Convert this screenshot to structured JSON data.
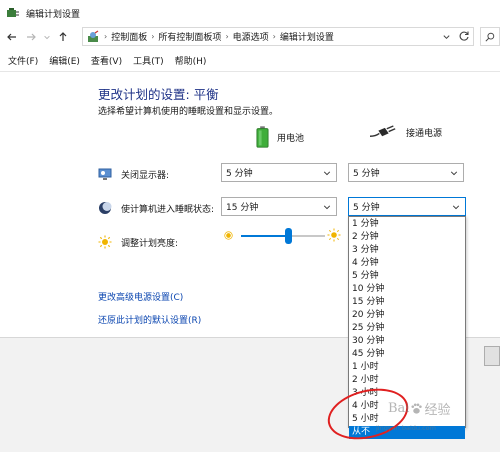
{
  "window": {
    "title": "编辑计划设置"
  },
  "address": {
    "crumbs": [
      "控制面板",
      "所有控制面板项",
      "电源选项",
      "编辑计划设置"
    ],
    "sep": "›"
  },
  "menu": [
    "文件(F)",
    "编辑(E)",
    "查看(V)",
    "工具(T)",
    "帮助(H)"
  ],
  "page": {
    "heading": "更改计划的设置: 平衡",
    "subtitle": "选择希望计算机使用的睡眠设置和显示设置。",
    "col_battery": "用电池",
    "col_plugged": "接通电源",
    "rows": {
      "display_off": "关闭显示器:",
      "sleep": "使计算机进入睡眠状态:",
      "brightness": "调整计划亮度:"
    },
    "values": {
      "display_battery": "5 分钟",
      "display_plugged": "5 分钟",
      "sleep_battery": "15 分钟",
      "sleep_plugged": "5 分钟"
    },
    "brightness_battery_fraction": 0.56,
    "links": {
      "advanced": "更改高级电源设置(C)",
      "restore": "还原此计划的默认设置(R)"
    }
  },
  "dropdown": {
    "options": [
      "1 分钟",
      "2 分钟",
      "3 分钟",
      "4 分钟",
      "5 分钟",
      "10 分钟",
      "15 分钟",
      "20 分钟",
      "25 分钟",
      "30 分钟",
      "45 分钟",
      "1 小时",
      "2 小时",
      "3 小时",
      "4 小时",
      "5 小时",
      "从不"
    ],
    "highlighted": "从不"
  },
  "watermark": {
    "brand": "Bai",
    "brand_tail": "经验",
    "sub": "jingyan.baidu.com"
  },
  "colors": {
    "accent": "#0078d7",
    "heading": "#1e3287",
    "link": "#0b46b0",
    "annotation": "#e02020"
  }
}
